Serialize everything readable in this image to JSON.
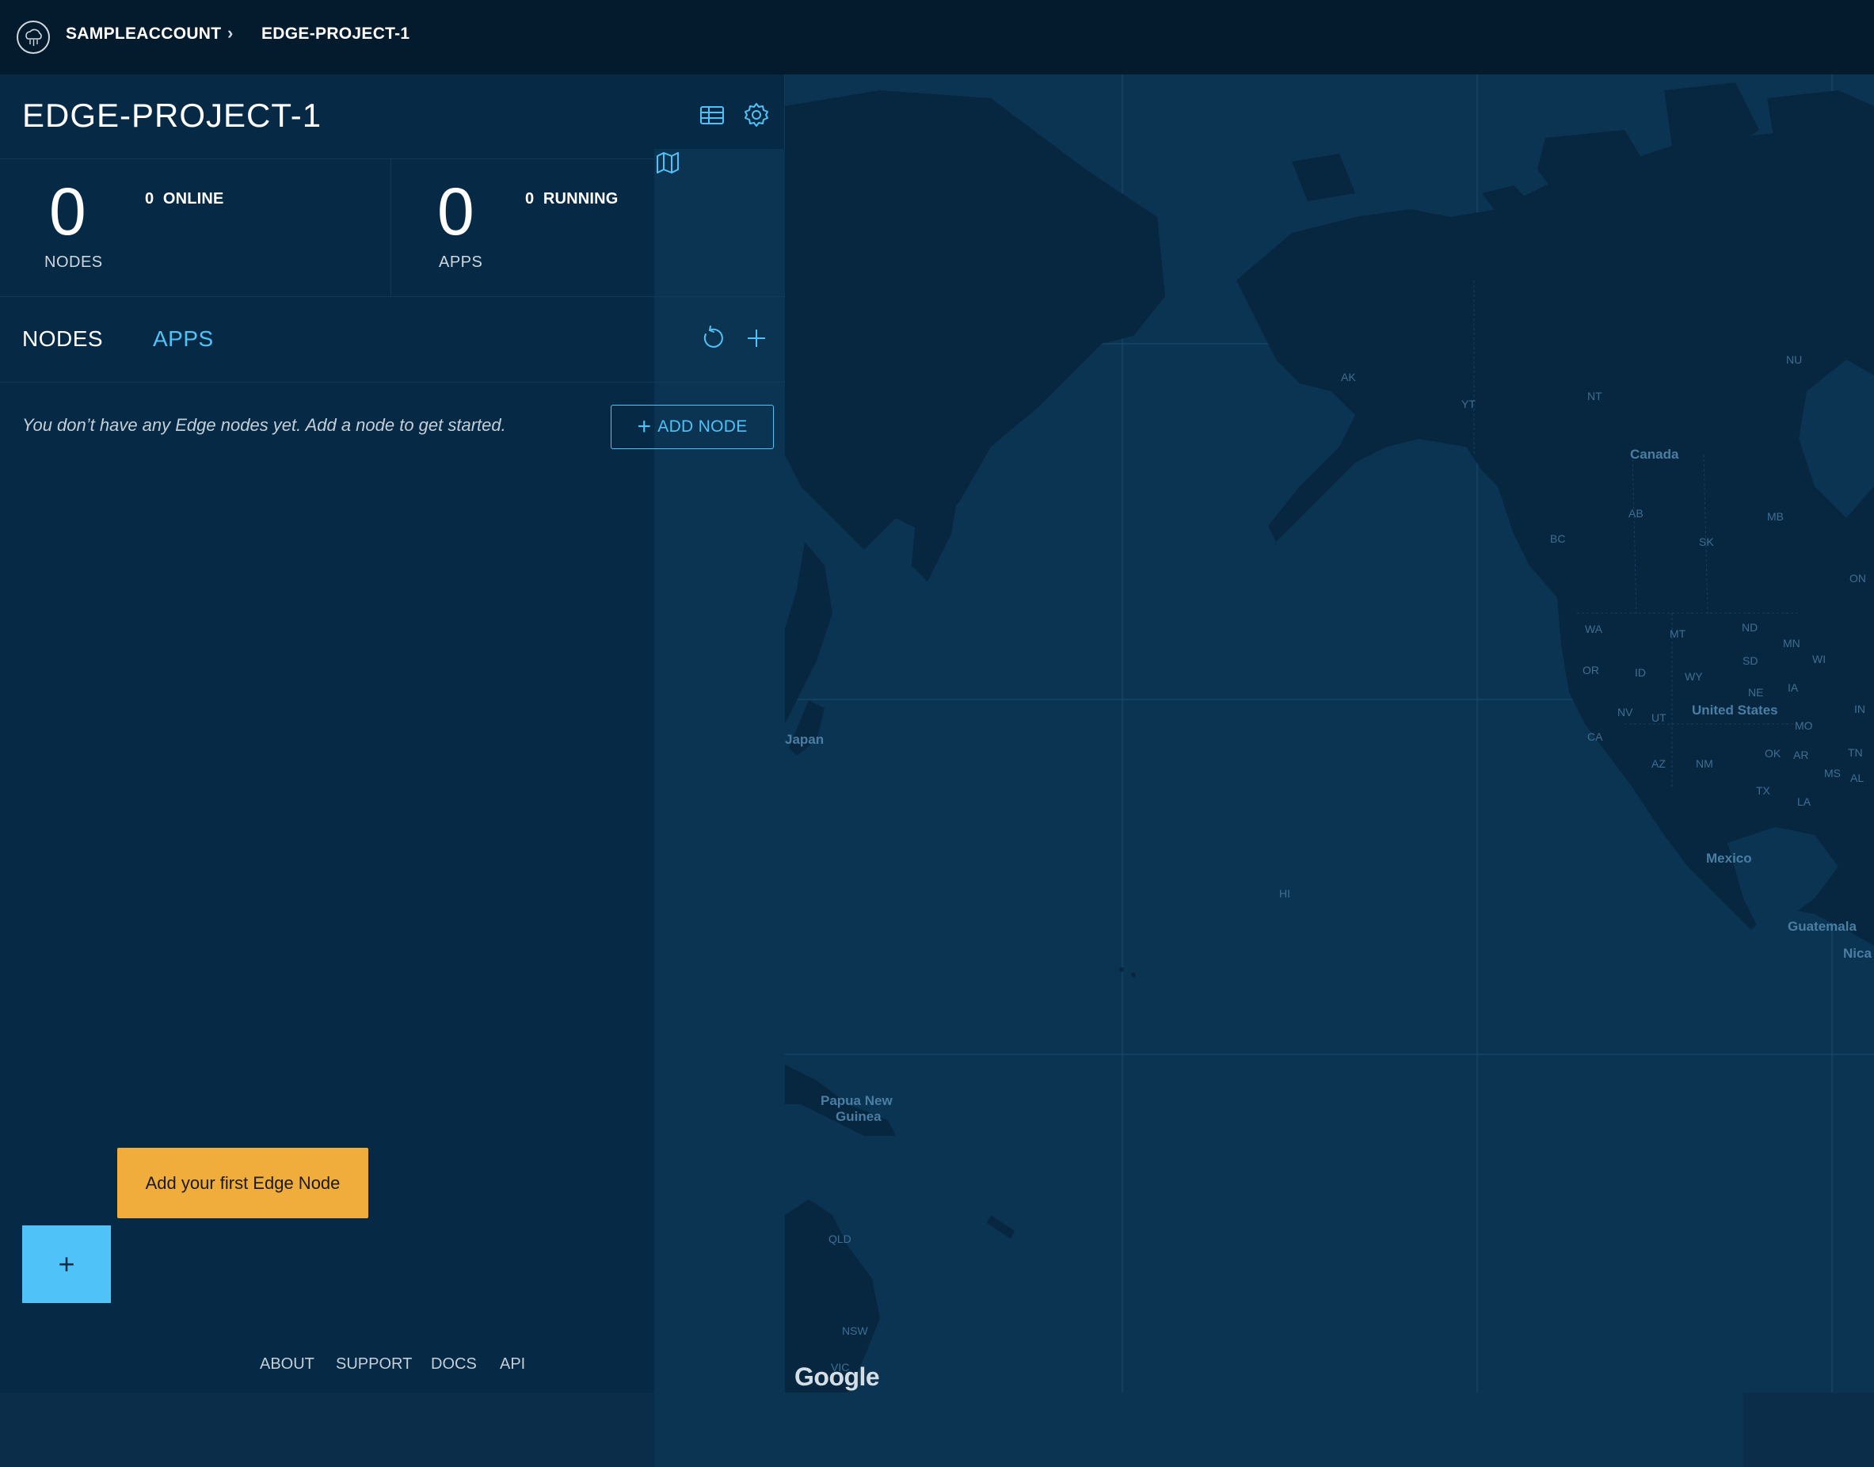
{
  "breadcrumb": {
    "account": "SAMPLEACCOUNT",
    "separator": "›",
    "project": "EDGE-PROJECT-1"
  },
  "project": {
    "title": "EDGE-PROJECT-1",
    "header_icons": [
      "map-icon",
      "table-icon",
      "gear-icon"
    ]
  },
  "stats": {
    "nodes": {
      "count": "0",
      "label": "NODES",
      "sub": "0  ONLINE"
    },
    "apps": {
      "count": "0",
      "label": "APPS",
      "sub": "0  RUNNING"
    }
  },
  "tabs": [
    {
      "label": "NODES",
      "active": true
    },
    {
      "label": "APPS",
      "active": false
    }
  ],
  "empty_state": {
    "message": "You don’t have any Edge nodes yet. Add a node to get started.",
    "button_label": "ADD NODE"
  },
  "tooltip": {
    "text": "Add your first Edge Node"
  },
  "fab": {
    "label": "+"
  },
  "footer": {
    "links": [
      "ABOUT",
      "SUPPORT",
      "DOCS",
      "API"
    ]
  },
  "map": {
    "labels": {
      "canada": "Canada",
      "united_states": "United States",
      "mexico": "Mexico",
      "guatemala": "Guatemala",
      "nica": "Nica",
      "japan": "Japan",
      "png": "Papua New\nGuinea",
      "png_1": "Papua New",
      "png_2": "Guinea",
      "ak": "AK",
      "yt": "YT",
      "nt": "NT",
      "nu": "NU",
      "bc": "BC",
      "ab": "AB",
      "sk": "SK",
      "mb": "MB",
      "on": "ON",
      "wa": "WA",
      "or": "OR",
      "id": "ID",
      "mt": "MT",
      "wy": "WY",
      "nd": "ND",
      "sd": "SD",
      "mn": "MN",
      "wi": "WI",
      "ia": "IA",
      "ne": "NE",
      "nv": "NV",
      "ut": "UT",
      "ca": "CA",
      "az": "AZ",
      "nm": "NM",
      "tx": "TX",
      "ok": "OK",
      "ar": "AR",
      "mo": "MO",
      "la": "LA",
      "ms": "MS",
      "al": "AL",
      "tn": "TN",
      "in": "IN",
      "hi": "HI",
      "qld": "QLD",
      "nsw": "NSW",
      "vic": "VIC"
    },
    "attribution": "Google"
  },
  "colors": {
    "topbar": "#041b2d",
    "panel": "#062a45",
    "accent": "#4fc3f7",
    "tooltip": "#f0ad3c",
    "map_water": "#0b3453",
    "map_land": "#072640"
  }
}
